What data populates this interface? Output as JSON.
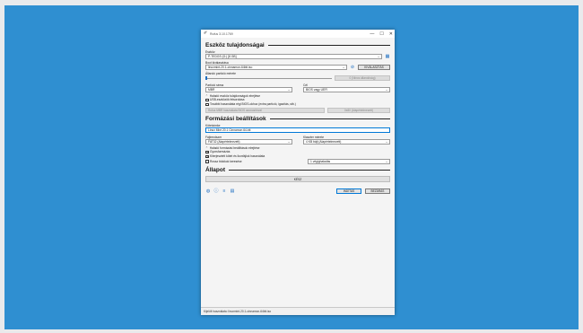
{
  "window": {
    "title": "Rufus 3.10.1769",
    "controls": {
      "minimize": "—",
      "maximize": "☐",
      "close": "✕"
    }
  },
  "drive_properties": {
    "heading": "Eszköz tulajdonságai",
    "device_label": "Eszköz",
    "device_value": "P-TEDGS (G:) [8 GB]",
    "boot_label": "Boot kiválasztása",
    "boot_value": "linuxmint-20.1-cinnamon-64bit.iso",
    "select_button": "KIVÁLASZTÁS",
    "persistent_label": "Állandó partíció mérete",
    "persistent_value": "0 (Nincs állandóság)",
    "persistent_level": 0,
    "partition_label": "Partíció séma",
    "partition_value": "MBR",
    "target_label": "Cél",
    "target_value": "BIOS vagy UEFI",
    "advanced_toggle": "Haladó eszköz tulajdonságok elrejtése",
    "list_usb": "USB-eszközök felsorolása",
    "bios_fixes": "További használata régi BIOS-okhoz (extra partíció, igazítás, stb.)",
    "rufus_mbr": "Rufus MBR használata BIOS azonosítóval",
    "bios_id_value": "0x80 (Alapértelmezett)"
  },
  "format_options": {
    "heading": "Formázási beállítások",
    "volume_label": "Kötetcímke",
    "volume_value": "Linux Mint 20.1 Cinnamon 64-bit",
    "filesystem_label": "Fájlrendszer",
    "filesystem_value": "FAT32 (Alapértelmezett)",
    "cluster_label": "Klaszter mérete",
    "cluster_value": "4 KB bájt (Alapértelmezett)",
    "advanced_toggle": "Haladó formázási beállítások elrejtése",
    "quick_format": "Gyorsformázás",
    "extended_label": "Kiterjesztett kötet és ikonfájlok használata",
    "bad_blocks": "Rossz blokkok keresése",
    "passes_value": "1 végighaladás",
    "quick_checked": "✔",
    "extended_checked": "✔"
  },
  "status": {
    "heading": "Állapot",
    "progress_text": "KÉSZ",
    "progress_value": 1.0,
    "progress_color": "#06b025"
  },
  "footer": {
    "icons": [
      "globe-icon",
      "info-icon",
      "settings-icon",
      "log-icon"
    ],
    "start_button": "INDÍTÁS",
    "close_button": "BEZÁRÁS",
    "statusbar": "Kijelölt használata: linuxmint-20.1-cinnamon-64bit.iso"
  },
  "colors": {
    "desktop": "#2f8fd1",
    "accent": "#0078d7"
  }
}
